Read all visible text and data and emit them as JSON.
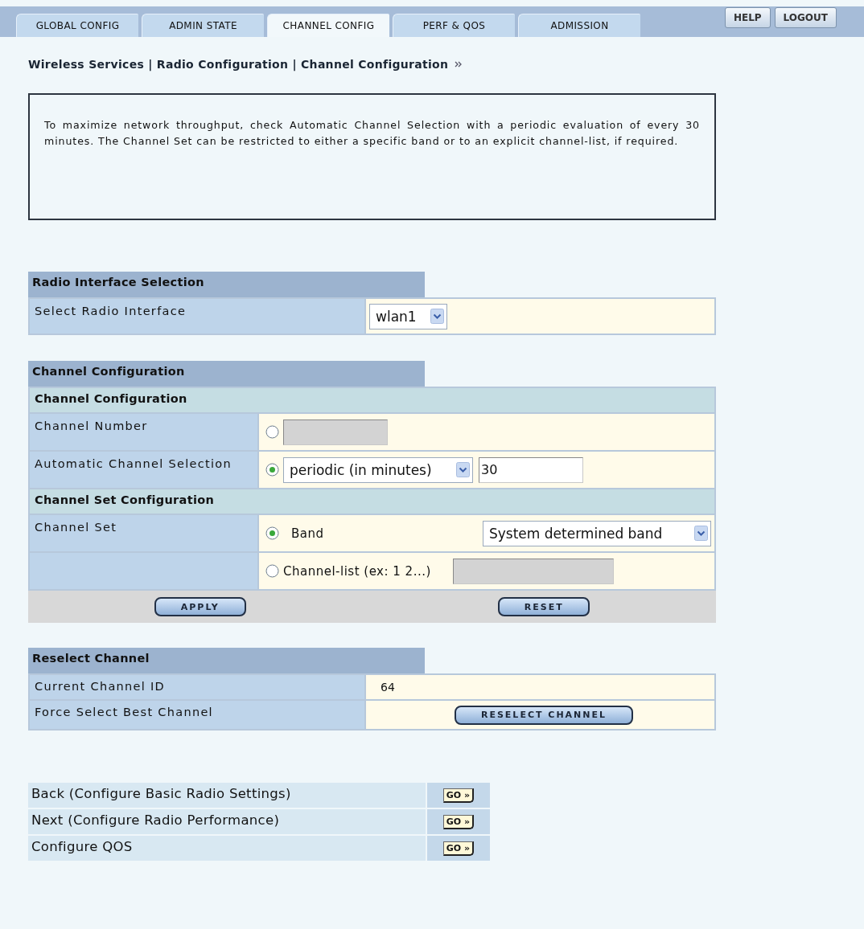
{
  "tabs": [
    {
      "label": "GLOBAL CONFIG",
      "selected": false
    },
    {
      "label": "ADMIN STATE",
      "selected": false
    },
    {
      "label": "CHANNEL CONFIG",
      "selected": true
    },
    {
      "label": "PERF & QOS",
      "selected": false
    },
    {
      "label": "ADMISSION",
      "selected": false
    }
  ],
  "header_buttons": [
    "HELP",
    "LOGOUT"
  ],
  "breadcrumb": "Wireless Services | Radio Configuration | Channel Configuration",
  "info_text": "To maximize network throughput, check Automatic Channel Selection with a periodic evaluation of every 30 minutes. The Channel Set can be restricted to either a specific band or to an explicit channel-list, if required.",
  "radio_interface": {
    "title": "Radio Interface Selection",
    "label": "Select Radio Interface",
    "select": "wlan1"
  },
  "channel_config": {
    "title": "Channel Configuration",
    "subtitle": "Channel Configuration",
    "channel_number": {
      "label": "Channel Number",
      "selected": false,
      "field_disabled": true
    },
    "auto": {
      "label": "Automatic Channel Selection",
      "selected": true,
      "mode": "periodic (in minutes)",
      "interval": "30"
    },
    "set_title": "Channel Set Configuration",
    "channel_set": {
      "label": "Channel Set",
      "options": [
        {
          "kind": "band",
          "label": "Band",
          "selected": true,
          "select": "System determined band"
        },
        {
          "kind": "list",
          "label": "Channel-list (ex: 1 2...)",
          "selected": false,
          "field_disabled": true
        }
      ]
    },
    "buttons": [
      "APPLY",
      "RESET"
    ]
  },
  "reselect": {
    "title": "Reselect Channel",
    "current_label": "Current Channel ID",
    "current_value": "64",
    "force_label": "Force Select Best Channel",
    "button": "RESELECT CHANNEL"
  },
  "nav_links": [
    {
      "label": "Back (Configure Basic Radio Settings)",
      "button": "GO »"
    },
    {
      "label": "Next (Configure Radio Performance)",
      "button": "GO »"
    },
    {
      "label": "Configure QOS",
      "button": "GO »"
    }
  ]
}
